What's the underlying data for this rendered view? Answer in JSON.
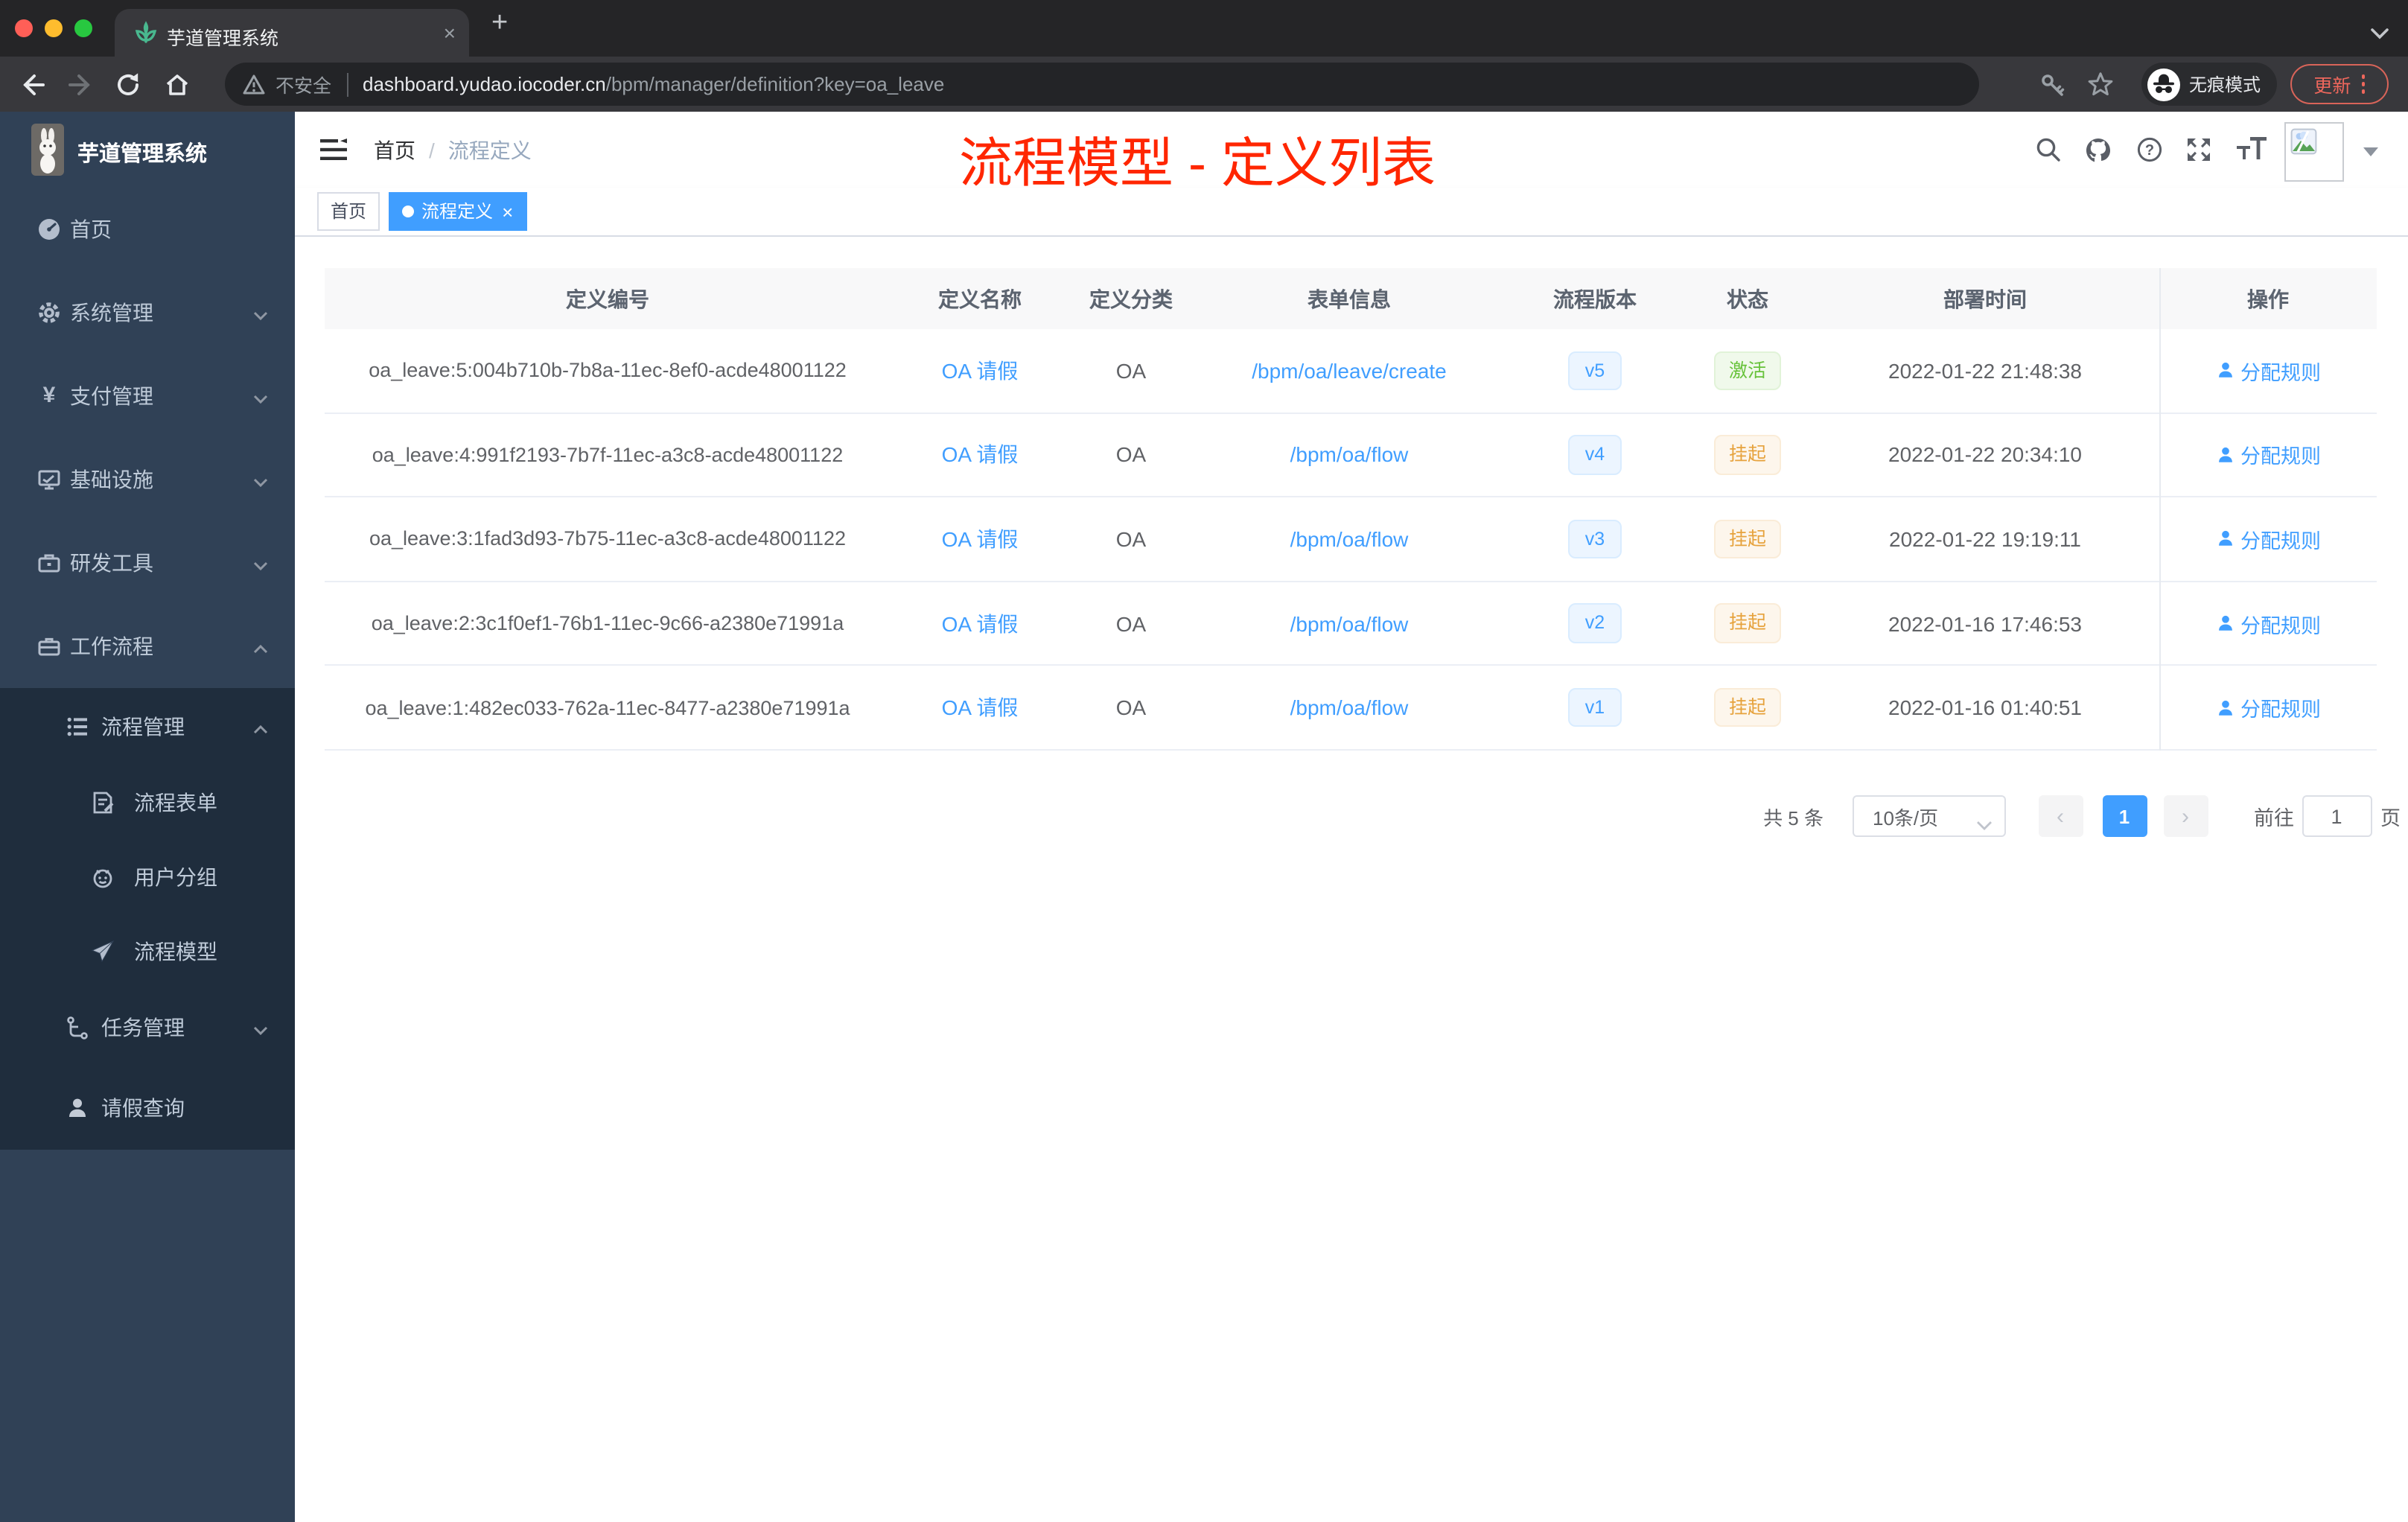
{
  "browser": {
    "tab_title": "芋道管理系统",
    "security_label": "不安全",
    "url_host": "dashboard.yudao.iocoder.cn",
    "url_path": "/bpm/manager/definition?key=oa_leave",
    "incognito_label": "无痕模式",
    "update_label": "更新"
  },
  "sidebar": {
    "app_title": "芋道管理系统",
    "items": [
      {
        "label": "首页"
      },
      {
        "label": "系统管理"
      },
      {
        "label": "支付管理"
      },
      {
        "label": "基础设施"
      },
      {
        "label": "研发工具"
      },
      {
        "label": "工作流程"
      },
      {
        "label": "流程管理"
      },
      {
        "label": "流程表单"
      },
      {
        "label": "用户分组"
      },
      {
        "label": "流程模型"
      },
      {
        "label": "任务管理"
      },
      {
        "label": "请假查询"
      }
    ]
  },
  "header": {
    "breadcrumb": {
      "home": "首页",
      "separator": "/",
      "current": "流程定义"
    },
    "annotation": "流程模型 - 定义列表"
  },
  "tags": [
    {
      "label": "首页"
    },
    {
      "label": "流程定义"
    }
  ],
  "table": {
    "columns": [
      "定义编号",
      "定义名称",
      "定义分类",
      "表单信息",
      "流程版本",
      "状态",
      "部署时间",
      "操作"
    ],
    "action_label": "分配规则",
    "rows": [
      {
        "id": "oa_leave:5:004b710b-7b8a-11ec-8ef0-acde48001122",
        "name": "OA 请假",
        "category": "OA",
        "form": "/bpm/oa/leave/create",
        "version": "v5",
        "status": "激活",
        "status_type": "success",
        "time": "2022-01-22 21:48:38",
        "action": "分配规则"
      },
      {
        "id": "oa_leave:4:991f2193-7b7f-11ec-a3c8-acde48001122",
        "name": "OA 请假",
        "category": "OA",
        "form": "/bpm/oa/flow",
        "version": "v4",
        "status": "挂起",
        "status_type": "warning",
        "time": "2022-01-22 20:34:10",
        "action": "分配规则"
      },
      {
        "id": "oa_leave:3:1fad3d93-7b75-11ec-a3c8-acde48001122",
        "name": "OA 请假",
        "category": "OA",
        "form": "/bpm/oa/flow",
        "version": "v3",
        "status": "挂起",
        "status_type": "warning",
        "time": "2022-01-22 19:19:11",
        "action": "分配规则"
      },
      {
        "id": "oa_leave:2:3c1f0ef1-76b1-11ec-9c66-a2380e71991a",
        "name": "OA 请假",
        "category": "OA",
        "form": "/bpm/oa/flow",
        "version": "v2",
        "status": "挂起",
        "status_type": "warning",
        "time": "2022-01-16 17:46:53",
        "action": "分配规则"
      },
      {
        "id": "oa_leave:1:482ec033-762a-11ec-8477-a2380e71991a",
        "name": "OA 请假",
        "category": "OA",
        "form": "/bpm/oa/flow",
        "version": "v1",
        "status": "挂起",
        "status_type": "warning",
        "time": "2022-01-16 01:40:51",
        "action": "分配规则"
      }
    ]
  },
  "pagination": {
    "total": "共 5 条",
    "page_size": "10条/页",
    "current_page": "1",
    "goto_label": "前往",
    "goto_value": "1",
    "page_label": "页"
  },
  "colors": {
    "accent": "#409eff",
    "success": "#67c23a",
    "warning": "#e6a23c",
    "annotation_red": "#ff2600",
    "sidebar_bg": "#304156",
    "submenu_bg": "#1f2d3d"
  }
}
